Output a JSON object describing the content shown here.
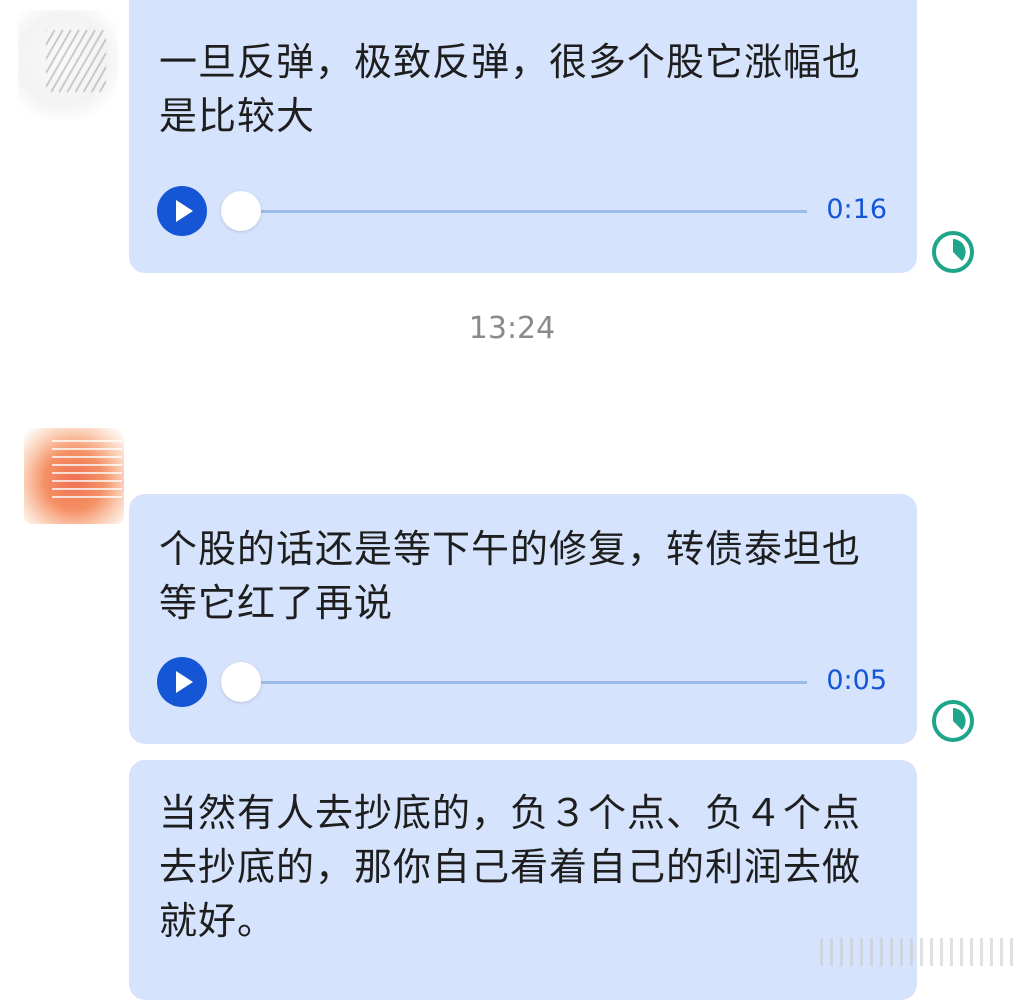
{
  "messages": [
    {
      "text": "一旦反弹，极致反弹，很多个股它涨幅也是比较大",
      "duration": "0:16",
      "play_icon": "play-icon",
      "status_icon": "clock-pie-icon"
    },
    {
      "text": "个股的话还是等下午的修复，转债泰坦也等它红了再说",
      "duration": "0:05",
      "play_icon": "play-icon",
      "status_icon": "clock-pie-icon"
    },
    {
      "text": "当然有人去抄底的，负３个点、负４个点去抄底的，那你自己看着自己的利润去做就好。"
    }
  ],
  "timestamp": "13:24",
  "colors": {
    "bubble": "#d5e3fc",
    "accent": "#1456d6",
    "status_icon": "#1fa58a",
    "timestamp": "#8a8a8a"
  },
  "audio_progress": [
    0,
    0
  ]
}
